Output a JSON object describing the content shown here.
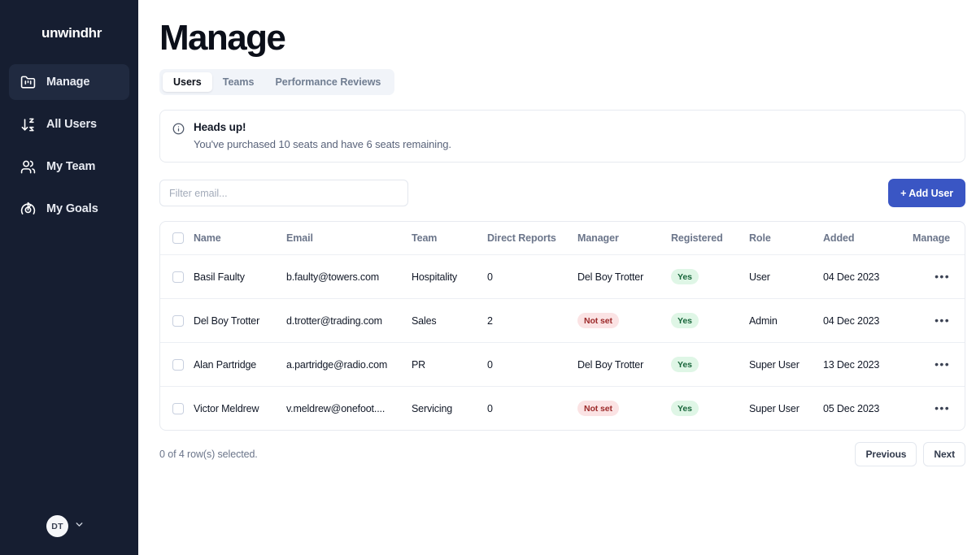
{
  "sidebar": {
    "logo": "unwindhr",
    "items": [
      {
        "label": "Manage",
        "icon": "folder-kanban-icon",
        "active": true
      },
      {
        "label": "All Users",
        "icon": "arrow-down-az-icon",
        "active": false
      },
      {
        "label": "My Team",
        "icon": "users-icon",
        "active": false
      },
      {
        "label": "My Goals",
        "icon": "goal-target-icon",
        "active": false
      }
    ],
    "user": {
      "initials": "DT",
      "chevron_icon": "chevron-down-icon"
    }
  },
  "header": {
    "title": "Manage",
    "tabs": [
      {
        "label": "Users",
        "active": true
      },
      {
        "label": "Teams",
        "active": false
      },
      {
        "label": "Performance Reviews",
        "active": false
      }
    ]
  },
  "alert": {
    "icon": "info-circle-icon",
    "title": "Heads up!",
    "description": "You've purchased 10 seats and have 6 seats remaining."
  },
  "toolbar": {
    "filter_placeholder": "Filter email...",
    "filter_value": "",
    "add_user_label": "+ Add User"
  },
  "table": {
    "columns": [
      "Name",
      "Email",
      "Team",
      "Direct Reports",
      "Manager",
      "Registered",
      "Role",
      "Added",
      "Manage"
    ],
    "rows": [
      {
        "name": "Basil Faulty",
        "email": "b.faulty@towers.com",
        "team": "Hospitality",
        "direct_reports": "0",
        "manager": "Del Boy Trotter",
        "manager_badge": false,
        "registered": "Yes",
        "role": "User",
        "added": "04 Dec 2023",
        "menu": "•••"
      },
      {
        "name": "Del Boy Trotter",
        "email": "d.trotter@trading.com",
        "team": "Sales",
        "direct_reports": "2",
        "manager": "Not set",
        "manager_badge": true,
        "registered": "Yes",
        "role": "Admin",
        "added": "04 Dec 2023",
        "menu": "•••"
      },
      {
        "name": "Alan Partridge",
        "email": "a.partridge@radio.com",
        "team": "PR",
        "direct_reports": "0",
        "manager": "Del Boy Trotter",
        "manager_badge": false,
        "registered": "Yes",
        "role": "Super User",
        "added": "13 Dec 2023",
        "menu": "•••"
      },
      {
        "name": "Victor Meldrew",
        "email": "v.meldrew@onefoot....",
        "team": "Servicing",
        "direct_reports": "0",
        "manager": "Not set",
        "manager_badge": true,
        "registered": "Yes",
        "role": "Super User",
        "added": "05 Dec 2023",
        "menu": "•••"
      }
    ]
  },
  "footer": {
    "selection": "0 of 4 row(s) selected.",
    "previous_label": "Previous",
    "next_label": "Next"
  },
  "colors": {
    "sidebar_bg": "#161e31",
    "accent_blue": "#3a56c4",
    "badge_yes_bg": "#dff6e6",
    "badge_yes_text": "#18653a",
    "badge_notset_bg": "#fbe3e4",
    "badge_notset_text": "#9c2a2a",
    "border": "#e7eaf0"
  }
}
